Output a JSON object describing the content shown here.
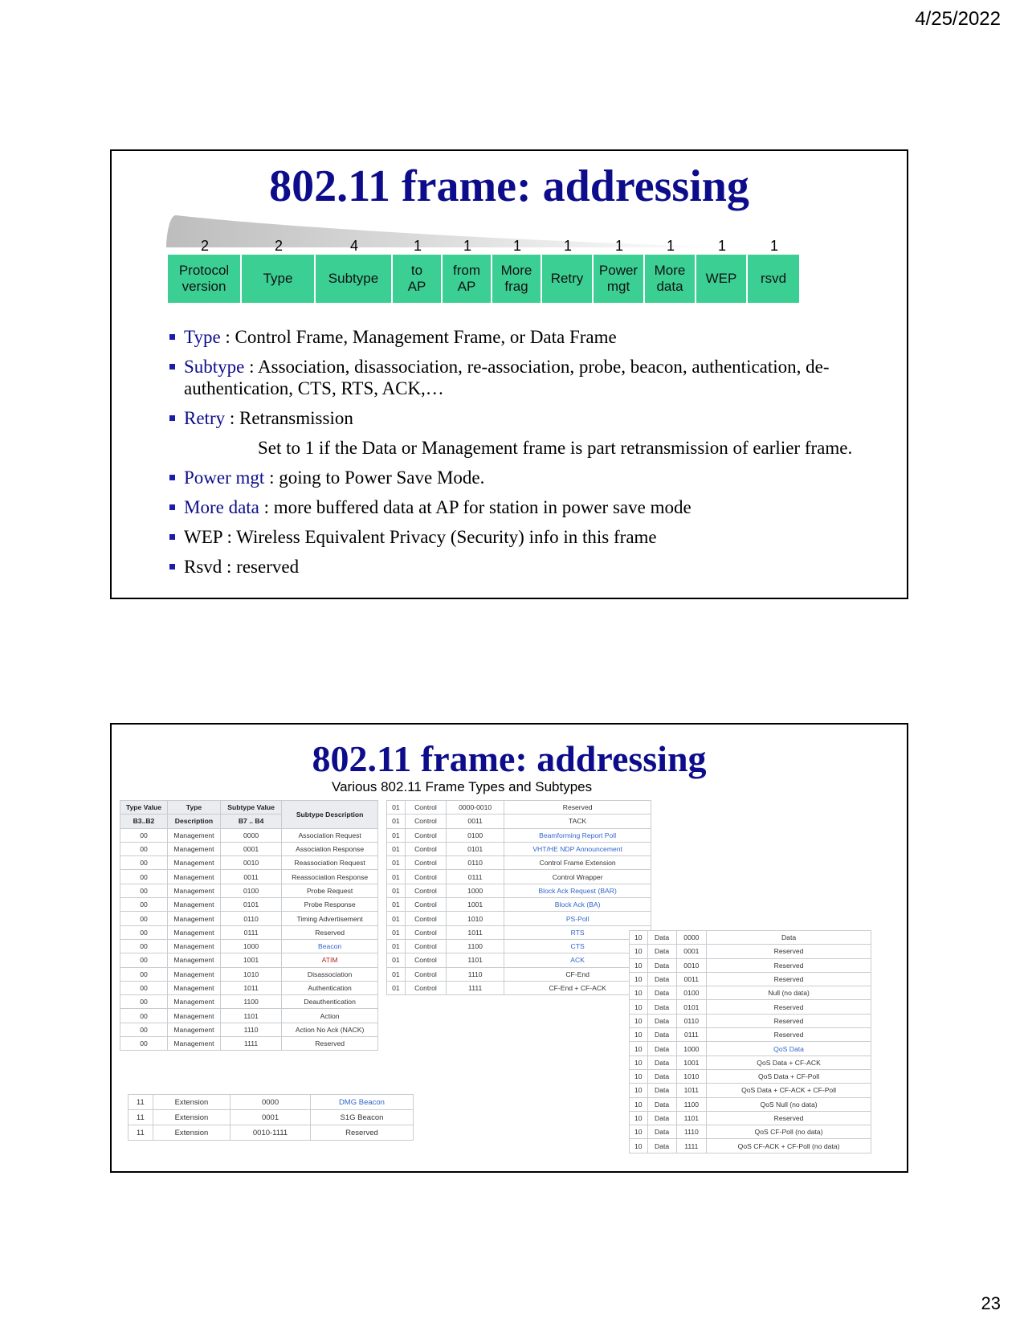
{
  "header": {
    "date": "4/25/2022"
  },
  "footer": {
    "page_number": "23"
  },
  "slide1": {
    "title": "802.11 frame: addressing",
    "fields": [
      {
        "size": "2",
        "label": "Protocol\nversion"
      },
      {
        "size": "2",
        "label": "Type"
      },
      {
        "size": "4",
        "label": "Subtype"
      },
      {
        "size": "1",
        "label": "to\nAP"
      },
      {
        "size": "1",
        "label": "from\nAP"
      },
      {
        "size": "1",
        "label": "More\nfrag"
      },
      {
        "size": "1",
        "label": "Retry"
      },
      {
        "size": "1",
        "label": "Power\nmgt"
      },
      {
        "size": "1",
        "label": "More\ndata"
      },
      {
        "size": "1",
        "label": "WEP"
      },
      {
        "size": "1",
        "label": "rsvd"
      }
    ],
    "bullets": [
      {
        "term": "Type",
        "text": " : Control Frame, Management Frame, or Data Frame"
      },
      {
        "term": "Subtype",
        "text": " : Association, disassociation, re-association, probe, beacon, authentication, de-authentication, CTS, RTS, ACK,…"
      },
      {
        "term": "Retry",
        "text": " : Retransmission"
      },
      {
        "term": "",
        "text": "Set to 1 if the Data or Management frame is part retransmission of earlier frame."
      },
      {
        "term": "Power mgt",
        "text": " : going to Power Save Mode."
      },
      {
        "term": "More data",
        "text": " : more buffered data at AP for station in power save mode"
      },
      {
        "term": "",
        "text": "WEP : Wireless Equivalent Privacy (Security) info in this frame"
      },
      {
        "term": "",
        "text": "Rsvd  : reserved"
      }
    ]
  },
  "slide2": {
    "title": "802.11 frame: addressing",
    "caption": "Various 802.11 Frame Types and Subtypes",
    "mgmt_table": {
      "headers": [
        "Type Value",
        "Type",
        "Subtype Value",
        "Subtype Description",
        "B3..B2",
        "Description",
        "B7 .. B4"
      ],
      "rows": [
        [
          "00",
          "Management",
          "0000",
          "Association Request"
        ],
        [
          "00",
          "Management",
          "0001",
          "Association Response"
        ],
        [
          "00",
          "Management",
          "0010",
          "Reassociation Request"
        ],
        [
          "00",
          "Management",
          "0011",
          "Reassociation Response"
        ],
        [
          "00",
          "Management",
          "0100",
          "Probe Request"
        ],
        [
          "00",
          "Management",
          "0101",
          "Probe Response"
        ],
        [
          "00",
          "Management",
          "0110",
          "Timing Advertisement"
        ],
        [
          "00",
          "Management",
          "0111",
          "Reserved"
        ],
        [
          "00",
          "Management",
          "1000",
          "Beacon"
        ],
        [
          "00",
          "Management",
          "1001",
          "ATIM"
        ],
        [
          "00",
          "Management",
          "1010",
          "Disassociation"
        ],
        [
          "00",
          "Management",
          "1011",
          "Authentication"
        ],
        [
          "00",
          "Management",
          "1100",
          "Deauthentication"
        ],
        [
          "00",
          "Management",
          "1101",
          "Action"
        ],
        [
          "00",
          "Management",
          "1110",
          "Action No Ack (NACK)"
        ],
        [
          "00",
          "Management",
          "1111",
          "Reserved"
        ]
      ]
    },
    "ctrl_table": {
      "rows": [
        [
          "01",
          "Control",
          "0000-0010",
          "Reserved"
        ],
        [
          "01",
          "Control",
          "0011",
          "TACK"
        ],
        [
          "01",
          "Control",
          "0100",
          "Beamforming Report Poll"
        ],
        [
          "01",
          "Control",
          "0101",
          "VHT/HE NDP Announcement"
        ],
        [
          "01",
          "Control",
          "0110",
          "Control Frame Extension"
        ],
        [
          "01",
          "Control",
          "0111",
          "Control Wrapper"
        ],
        [
          "01",
          "Control",
          "1000",
          "Block Ack Request (BAR)"
        ],
        [
          "01",
          "Control",
          "1001",
          "Block Ack (BA)"
        ],
        [
          "01",
          "Control",
          "1010",
          "PS-Poll"
        ],
        [
          "01",
          "Control",
          "1011",
          "RTS"
        ],
        [
          "01",
          "Control",
          "1100",
          "CTS"
        ],
        [
          "01",
          "Control",
          "1101",
          "ACK"
        ],
        [
          "01",
          "Control",
          "1110",
          "CF-End"
        ],
        [
          "01",
          "Control",
          "1111",
          "CF-End + CF-ACK"
        ]
      ]
    },
    "data_table": {
      "rows": [
        [
          "10",
          "Data",
          "0000",
          "Data"
        ],
        [
          "10",
          "Data",
          "0001",
          "Reserved"
        ],
        [
          "10",
          "Data",
          "0010",
          "Reserved"
        ],
        [
          "10",
          "Data",
          "0011",
          "Reserved"
        ],
        [
          "10",
          "Data",
          "0100",
          "Null (no data)"
        ],
        [
          "10",
          "Data",
          "0101",
          "Reserved"
        ],
        [
          "10",
          "Data",
          "0110",
          "Reserved"
        ],
        [
          "10",
          "Data",
          "0111",
          "Reserved"
        ],
        [
          "10",
          "Data",
          "1000",
          "QoS Data"
        ],
        [
          "10",
          "Data",
          "1001",
          "QoS Data + CF-ACK"
        ],
        [
          "10",
          "Data",
          "1010",
          "QoS Data + CF-Poll"
        ],
        [
          "10",
          "Data",
          "1011",
          "QoS Data + CF-ACK + CF-Poll"
        ],
        [
          "10",
          "Data",
          "1100",
          "QoS Null (no data)"
        ],
        [
          "10",
          "Data",
          "1101",
          "Reserved"
        ],
        [
          "10",
          "Data",
          "1110",
          "QoS CF-Poll (no data)"
        ],
        [
          "10",
          "Data",
          "1111",
          "QoS CF-ACK + CF-Poll (no data)"
        ]
      ]
    },
    "ext_table": {
      "rows": [
        [
          "11",
          "Extension",
          "0000",
          "DMG Beacon"
        ],
        [
          "11",
          "Extension",
          "0001",
          "S1G Beacon"
        ],
        [
          "11",
          "Extension",
          "0010-1111",
          "Reserved"
        ]
      ]
    }
  }
}
